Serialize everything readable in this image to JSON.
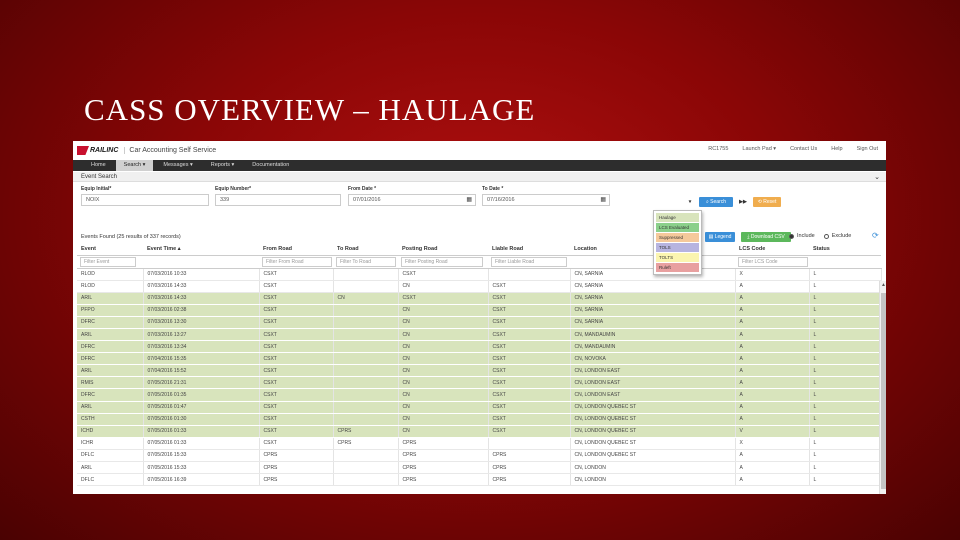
{
  "slide": {
    "title": "CASS OVERVIEW – HAULAGE"
  },
  "app": {
    "logo_text": "RAILINC",
    "name": "Car Accounting Self Service",
    "top_links": [
      "RC1755",
      "Launch Pad ▾",
      "Contact Us",
      "Help",
      "Sign Out"
    ]
  },
  "nav": {
    "items": [
      {
        "label": "Home",
        "active": false
      },
      {
        "label": "Search ▾",
        "active": true
      },
      {
        "label": "Messages ▾",
        "active": false
      },
      {
        "label": "Reports ▾",
        "active": false
      },
      {
        "label": "Documentation",
        "active": false
      }
    ]
  },
  "event_search": {
    "title": "Event Search",
    "equip_initial": {
      "label": "Equip Initial*",
      "value": "NOIX"
    },
    "equip_number": {
      "label": "Equip Number*",
      "value": "339"
    },
    "from_date": {
      "label": "From Date *",
      "value": "07/01/2016"
    },
    "to_date": {
      "label": "To Date *",
      "value": "07/16/2016"
    },
    "buttons": {
      "menu": "▾",
      "search": "Search",
      "fast_forward": "▶▶",
      "reset": "Reset",
      "legend": "Legend",
      "download": "Download CSV"
    }
  },
  "legend_dropdown": {
    "items": [
      {
        "label": "Haulage",
        "color": "#d8e4bc"
      },
      {
        "label": "LCS Evaluated",
        "color": "#8bd08b"
      },
      {
        "label": "Suppressed",
        "color": "#f5c99b"
      },
      {
        "label": "TOLS",
        "color": "#b7b4e0"
      },
      {
        "label": "TOLTS",
        "color": "#fbf5b0"
      },
      {
        "label": "Ruleft",
        "color": "#e8a0a0"
      }
    ]
  },
  "results": {
    "summary": "Events Found (25 results of 337 records)",
    "include_label": "Include",
    "exclude_label": "Exclude",
    "refresh_icon": "⟳"
  },
  "table": {
    "columns": [
      "Event",
      "Event Time ▴",
      "From Road",
      "To Road",
      "Posting Road",
      "Liable Road",
      "Location",
      "LCS Code",
      "Status"
    ],
    "filters": [
      "Filter Event",
      "",
      "Filter From Road",
      "Filter To Road",
      "Filter Posting Road",
      "Filter Liable Road",
      "",
      "Filter LCS Code",
      ""
    ],
    "rows": [
      {
        "cells": [
          "RLOD",
          "07/03/2016 10:33",
          "CSXT",
          "",
          "CSXT",
          "",
          "CN, SARNIA",
          "X",
          "L"
        ],
        "haulage": false
      },
      {
        "cells": [
          "RLOD",
          "07/03/2016 14:33",
          "CSXT",
          "",
          "CN",
          "CSXT",
          "CN, SARNIA",
          "A",
          "L"
        ],
        "haulage": false
      },
      {
        "cells": [
          "ARIL",
          "07/03/2016 14:33",
          "CSXT",
          "CN",
          "CSXT",
          "CSXT",
          "CN, SARNIA",
          "A",
          "L"
        ],
        "haulage": true
      },
      {
        "cells": [
          "PFPO",
          "07/03/2016 02:38",
          "CSXT",
          "",
          "CN",
          "CSXT",
          "CN, SARNIA",
          "A",
          "L"
        ],
        "haulage": true
      },
      {
        "cells": [
          "DFRC",
          "07/03/2016 13:30",
          "CSXT",
          "",
          "CN",
          "CSXT",
          "CN, SARNIA",
          "A",
          "L"
        ],
        "haulage": true
      },
      {
        "cells": [
          "ARIL",
          "07/03/2016 13:27",
          "CSXT",
          "",
          "CN",
          "CSXT",
          "CN, MANDAUMIN",
          "A",
          "L"
        ],
        "haulage": true
      },
      {
        "cells": [
          "DFRC",
          "07/03/2016 13:34",
          "CSXT",
          "",
          "CN",
          "CSXT",
          "CN, MANDAUMIN",
          "A",
          "L"
        ],
        "haulage": true
      },
      {
        "cells": [
          "DFRC",
          "07/04/2016 15:35",
          "CSXT",
          "",
          "CN",
          "CSXT",
          "CN, NOVOKA",
          "A",
          "L"
        ],
        "haulage": true
      },
      {
        "cells": [
          "ARIL",
          "07/04/2016 15:52",
          "CSXT",
          "",
          "CN",
          "CSXT",
          "CN, LONDON EAST",
          "A",
          "L"
        ],
        "haulage": true
      },
      {
        "cells": [
          "RMIS",
          "07/05/2016 21:31",
          "CSXT",
          "",
          "CN",
          "CSXT",
          "CN, LONDON EAST",
          "A",
          "L"
        ],
        "haulage": true
      },
      {
        "cells": [
          "DFRC",
          "07/05/2016 01:35",
          "CSXT",
          "",
          "CN",
          "CSXT",
          "CN, LONDON EAST",
          "A",
          "L"
        ],
        "haulage": true
      },
      {
        "cells": [
          "ARIL",
          "07/05/2016 01:47",
          "CSXT",
          "",
          "CN",
          "CSXT",
          "CN, LONDON QUEBEC ST",
          "A",
          "L"
        ],
        "haulage": true
      },
      {
        "cells": [
          "CSTH",
          "07/05/2016 01:30",
          "CSXT",
          "",
          "CN",
          "CSXT",
          "CN, LONDON QUEBEC ST",
          "A",
          "L"
        ],
        "haulage": true
      },
      {
        "cells": [
          "ICHD",
          "07/05/2016 01:33",
          "CSXT",
          "CPRS",
          "CN",
          "CSXT",
          "CN, LONDON QUEBEC ST",
          "V",
          "L"
        ],
        "haulage": true
      },
      {
        "cells": [
          "ICHR",
          "07/05/2016 01:33",
          "CSXT",
          "CPRS",
          "CPRS",
          "",
          "CN, LONDON QUEBEC ST",
          "X",
          "L"
        ],
        "haulage": false
      },
      {
        "cells": [
          "DFLC",
          "07/05/2016 15:33",
          "CPRS",
          "",
          "CPRS",
          "CPRS",
          "CN, LONDON QUEBEC ST",
          "A",
          "L"
        ],
        "haulage": false
      },
      {
        "cells": [
          "ARIL",
          "07/05/2016 15:33",
          "CPRS",
          "",
          "CPRS",
          "CPRS",
          "CN, LONDON",
          "A",
          "L"
        ],
        "haulage": false
      },
      {
        "cells": [
          "DFLC",
          "07/05/2016 16:39",
          "CPRS",
          "",
          "CPRS",
          "CPRS",
          "CN, LONDON",
          "A",
          "L"
        ],
        "haulage": false
      }
    ]
  }
}
